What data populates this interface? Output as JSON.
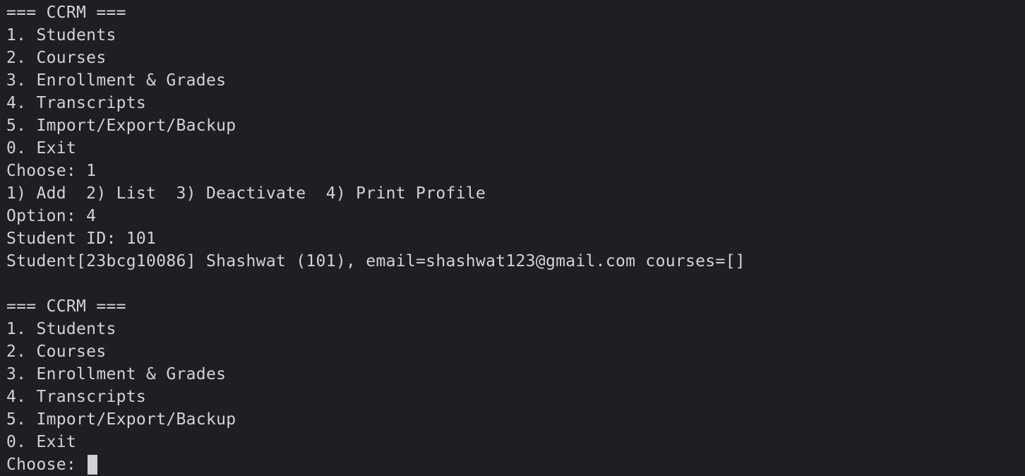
{
  "terminal": {
    "lines": [
      "=== CCRM ===",
      "1. Students",
      "2. Courses",
      "3. Enrollment & Grades",
      "4. Transcripts",
      "5. Import/Export/Backup",
      "0. Exit",
      "Choose: 1",
      "1) Add  2) List  3) Deactivate  4) Print Profile",
      "Option: 4",
      "Student ID: 101",
      "Student[23bcg10086] Shashwat (101), email=shashwat123@gmail.com courses=[]",
      "",
      "=== CCRM ===",
      "1. Students",
      "2. Courses",
      "3. Enrollment & Grades",
      "4. Transcripts",
      "5. Import/Export/Backup",
      "0. Exit"
    ],
    "prompt": "Choose: "
  },
  "colors": {
    "background": "#1e1f22",
    "text": "#d1d3d8",
    "cursor": "#cfd1d6"
  }
}
